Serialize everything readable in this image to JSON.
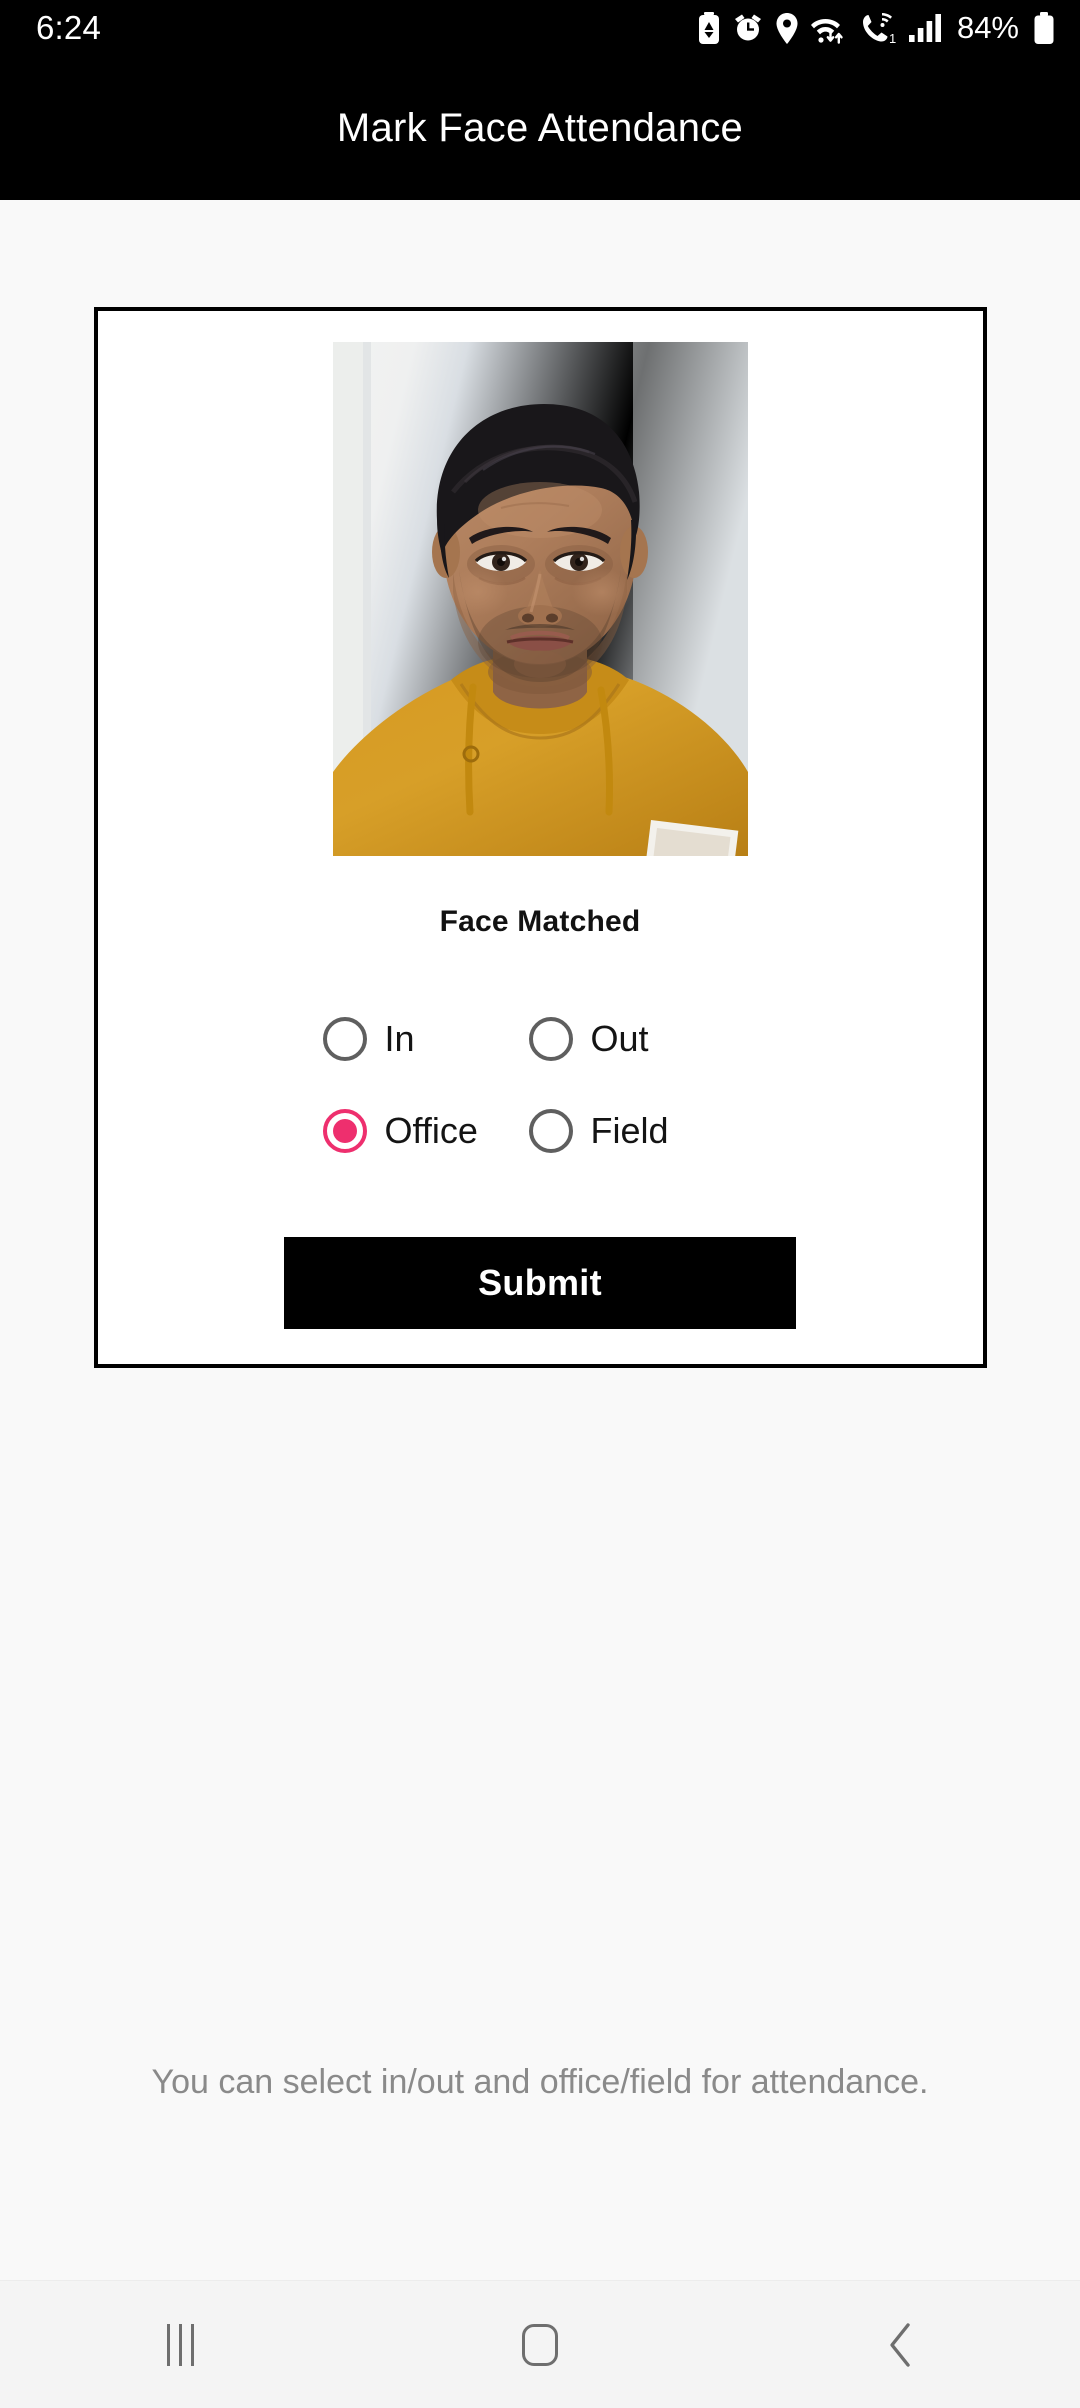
{
  "status_bar": {
    "time": "6:24",
    "battery_percent": "84%",
    "icons": [
      "battery-saver-icon",
      "alarm-icon",
      "location-icon",
      "wifi-data-transfer-icon",
      "wifi-calling-icon",
      "cellular-signal-icon",
      "battery-icon"
    ]
  },
  "app_bar": {
    "title": "Mark Face Attendance"
  },
  "card": {
    "photo_alt": "captured-face-photo",
    "face_status": "Face Matched",
    "attendance_type": {
      "options": [
        {
          "label": "In",
          "value": "in",
          "selected": false
        },
        {
          "label": "Out",
          "value": "out",
          "selected": false
        }
      ]
    },
    "location_type": {
      "options": [
        {
          "label": "Office",
          "value": "office",
          "selected": true
        },
        {
          "label": "Field",
          "value": "field",
          "selected": false
        }
      ]
    },
    "submit_label": "Submit"
  },
  "hint": {
    "text": "You can select in/out and office/field for attendance."
  },
  "nav_bar": {
    "recents_label": "recents-nav-button",
    "home_label": "home-nav-button",
    "back_label": "back-nav-button"
  },
  "colors": {
    "accent_pink": "#ee2f6e",
    "app_bar_bg": "#000000",
    "page_bg": "#f9f9f9",
    "hint_text": "#8a8a8a",
    "radio_unselected": "#5f5f5f"
  }
}
